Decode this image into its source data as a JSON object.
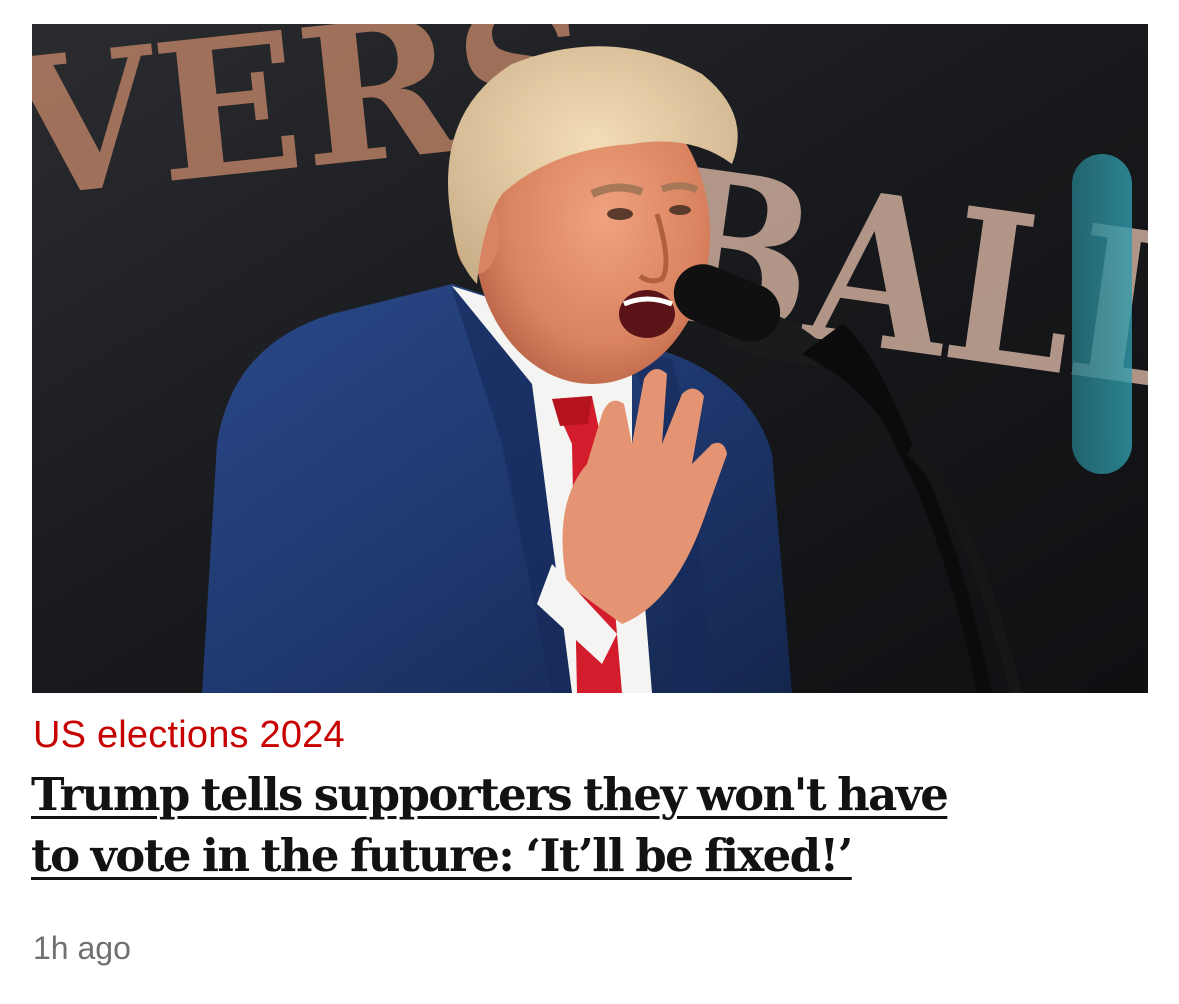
{
  "article": {
    "image_alt": "Trump speaking at a microphone in front of a sign",
    "background_sign_text_left": "VERS",
    "background_sign_text_right": "BALLC",
    "section_label": "US elections 2024",
    "headline_line1": "Trump tells supporters they won't have",
    "headline_line2": "to vote in the future: ‘It’ll be fixed!’",
    "timestamp": "1h ago"
  },
  "colors": {
    "section_label": "#c70000",
    "headline": "#121212",
    "timestamp": "#707070",
    "background": "#ffffff"
  }
}
